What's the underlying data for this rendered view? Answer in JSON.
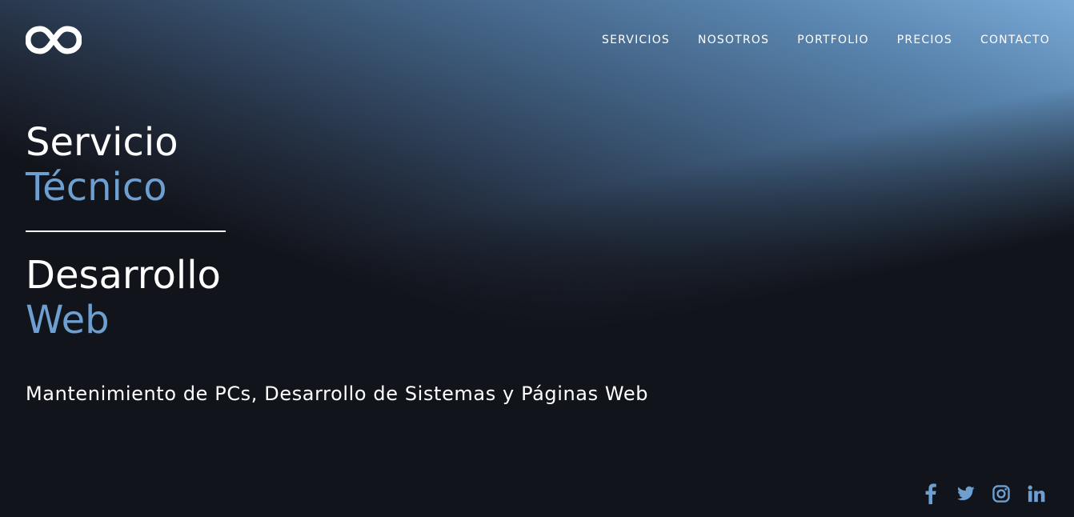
{
  "brand": {
    "logo_icon": "infinity-icon"
  },
  "nav": {
    "items": [
      {
        "label": "SERVICIOS"
      },
      {
        "label": "NOSOTROS"
      },
      {
        "label": "PORTFOLIO"
      },
      {
        "label": "PRECIOS"
      },
      {
        "label": "CONTACTO"
      }
    ]
  },
  "hero": {
    "block1": {
      "line1": "Servicio",
      "line2": "Técnico"
    },
    "block2": {
      "line1": "Desarrollo",
      "line2": "Web"
    },
    "subtitle": "Mantenimiento de PCs, Desarrollo de Sistemas y Páginas Web"
  },
  "social": {
    "icons": [
      "facebook-icon",
      "twitter-icon",
      "instagram-icon",
      "linkedin-icon"
    ]
  },
  "colors": {
    "accent": "#6d9fd1",
    "background": "#12141b",
    "text": "#ffffff",
    "sky_top": "#7aa9d6"
  }
}
